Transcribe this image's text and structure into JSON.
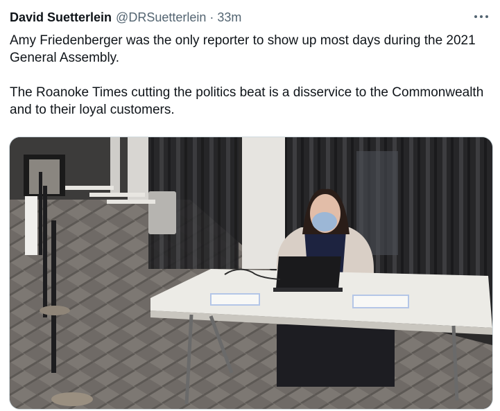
{
  "tweet": {
    "author_name": "David Suetterlein",
    "author_handle": "@DRSuetterlein",
    "separator": "·",
    "timestamp": "33m",
    "text_paragraphs": [
      "Amy Friedenberger was the only reporter to show up most days during the 2021 General Assembly.",
      "The Roanoke Times cutting the politics beat is a disservice to the Commonwealth and to their loyal customers."
    ],
    "more_icon": "more-horizontal-icon",
    "media": {
      "type": "photo"
    }
  },
  "colors": {
    "text_primary": "#0f1419",
    "text_secondary": "#536471",
    "border": "#cfd9de",
    "background": "#ffffff"
  }
}
